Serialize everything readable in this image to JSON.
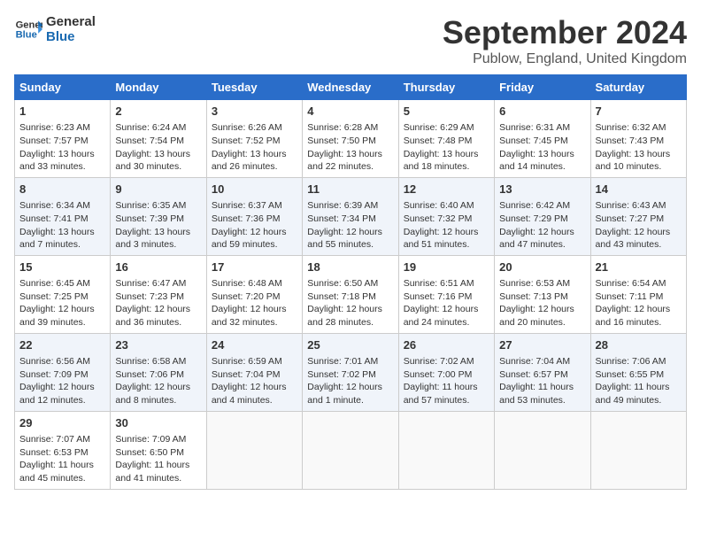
{
  "logo": {
    "line1": "General",
    "line2": "Blue"
  },
  "title": "September 2024",
  "location": "Publow, England, United Kingdom",
  "headers": [
    "Sunday",
    "Monday",
    "Tuesday",
    "Wednesday",
    "Thursday",
    "Friday",
    "Saturday"
  ],
  "weeks": [
    [
      {
        "day": "1",
        "info": "Sunrise: 6:23 AM\nSunset: 7:57 PM\nDaylight: 13 hours\nand 33 minutes."
      },
      {
        "day": "2",
        "info": "Sunrise: 6:24 AM\nSunset: 7:54 PM\nDaylight: 13 hours\nand 30 minutes."
      },
      {
        "day": "3",
        "info": "Sunrise: 6:26 AM\nSunset: 7:52 PM\nDaylight: 13 hours\nand 26 minutes."
      },
      {
        "day": "4",
        "info": "Sunrise: 6:28 AM\nSunset: 7:50 PM\nDaylight: 13 hours\nand 22 minutes."
      },
      {
        "day": "5",
        "info": "Sunrise: 6:29 AM\nSunset: 7:48 PM\nDaylight: 13 hours\nand 18 minutes."
      },
      {
        "day": "6",
        "info": "Sunrise: 6:31 AM\nSunset: 7:45 PM\nDaylight: 13 hours\nand 14 minutes."
      },
      {
        "day": "7",
        "info": "Sunrise: 6:32 AM\nSunset: 7:43 PM\nDaylight: 13 hours\nand 10 minutes."
      }
    ],
    [
      {
        "day": "8",
        "info": "Sunrise: 6:34 AM\nSunset: 7:41 PM\nDaylight: 13 hours\nand 7 minutes."
      },
      {
        "day": "9",
        "info": "Sunrise: 6:35 AM\nSunset: 7:39 PM\nDaylight: 13 hours\nand 3 minutes."
      },
      {
        "day": "10",
        "info": "Sunrise: 6:37 AM\nSunset: 7:36 PM\nDaylight: 12 hours\nand 59 minutes."
      },
      {
        "day": "11",
        "info": "Sunrise: 6:39 AM\nSunset: 7:34 PM\nDaylight: 12 hours\nand 55 minutes."
      },
      {
        "day": "12",
        "info": "Sunrise: 6:40 AM\nSunset: 7:32 PM\nDaylight: 12 hours\nand 51 minutes."
      },
      {
        "day": "13",
        "info": "Sunrise: 6:42 AM\nSunset: 7:29 PM\nDaylight: 12 hours\nand 47 minutes."
      },
      {
        "day": "14",
        "info": "Sunrise: 6:43 AM\nSunset: 7:27 PM\nDaylight: 12 hours\nand 43 minutes."
      }
    ],
    [
      {
        "day": "15",
        "info": "Sunrise: 6:45 AM\nSunset: 7:25 PM\nDaylight: 12 hours\nand 39 minutes."
      },
      {
        "day": "16",
        "info": "Sunrise: 6:47 AM\nSunset: 7:23 PM\nDaylight: 12 hours\nand 36 minutes."
      },
      {
        "day": "17",
        "info": "Sunrise: 6:48 AM\nSunset: 7:20 PM\nDaylight: 12 hours\nand 32 minutes."
      },
      {
        "day": "18",
        "info": "Sunrise: 6:50 AM\nSunset: 7:18 PM\nDaylight: 12 hours\nand 28 minutes."
      },
      {
        "day": "19",
        "info": "Sunrise: 6:51 AM\nSunset: 7:16 PM\nDaylight: 12 hours\nand 24 minutes."
      },
      {
        "day": "20",
        "info": "Sunrise: 6:53 AM\nSunset: 7:13 PM\nDaylight: 12 hours\nand 20 minutes."
      },
      {
        "day": "21",
        "info": "Sunrise: 6:54 AM\nSunset: 7:11 PM\nDaylight: 12 hours\nand 16 minutes."
      }
    ],
    [
      {
        "day": "22",
        "info": "Sunrise: 6:56 AM\nSunset: 7:09 PM\nDaylight: 12 hours\nand 12 minutes."
      },
      {
        "day": "23",
        "info": "Sunrise: 6:58 AM\nSunset: 7:06 PM\nDaylight: 12 hours\nand 8 minutes."
      },
      {
        "day": "24",
        "info": "Sunrise: 6:59 AM\nSunset: 7:04 PM\nDaylight: 12 hours\nand 4 minutes."
      },
      {
        "day": "25",
        "info": "Sunrise: 7:01 AM\nSunset: 7:02 PM\nDaylight: 12 hours\nand 1 minute."
      },
      {
        "day": "26",
        "info": "Sunrise: 7:02 AM\nSunset: 7:00 PM\nDaylight: 11 hours\nand 57 minutes."
      },
      {
        "day": "27",
        "info": "Sunrise: 7:04 AM\nSunset: 6:57 PM\nDaylight: 11 hours\nand 53 minutes."
      },
      {
        "day": "28",
        "info": "Sunrise: 7:06 AM\nSunset: 6:55 PM\nDaylight: 11 hours\nand 49 minutes."
      }
    ],
    [
      {
        "day": "29",
        "info": "Sunrise: 7:07 AM\nSunset: 6:53 PM\nDaylight: 11 hours\nand 45 minutes."
      },
      {
        "day": "30",
        "info": "Sunrise: 7:09 AM\nSunset: 6:50 PM\nDaylight: 11 hours\nand 41 minutes."
      },
      {
        "day": "",
        "info": ""
      },
      {
        "day": "",
        "info": ""
      },
      {
        "day": "",
        "info": ""
      },
      {
        "day": "",
        "info": ""
      },
      {
        "day": "",
        "info": ""
      }
    ]
  ]
}
